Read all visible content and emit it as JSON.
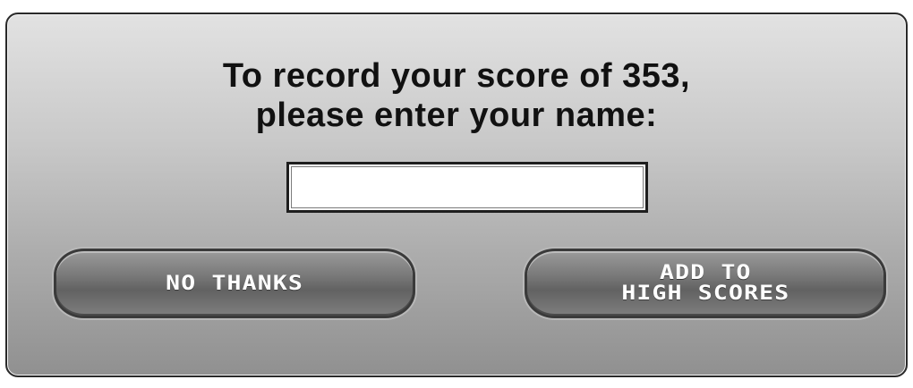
{
  "dialog": {
    "prompt_line1": "To record your score of 353,",
    "prompt_line2": "please enter your name:",
    "score": 353,
    "name_input": {
      "value": "",
      "placeholder": ""
    },
    "buttons": {
      "no_thanks": "NO THANKS",
      "add_line1": "ADD TO",
      "add_line2": "HIGH SCORES"
    }
  }
}
